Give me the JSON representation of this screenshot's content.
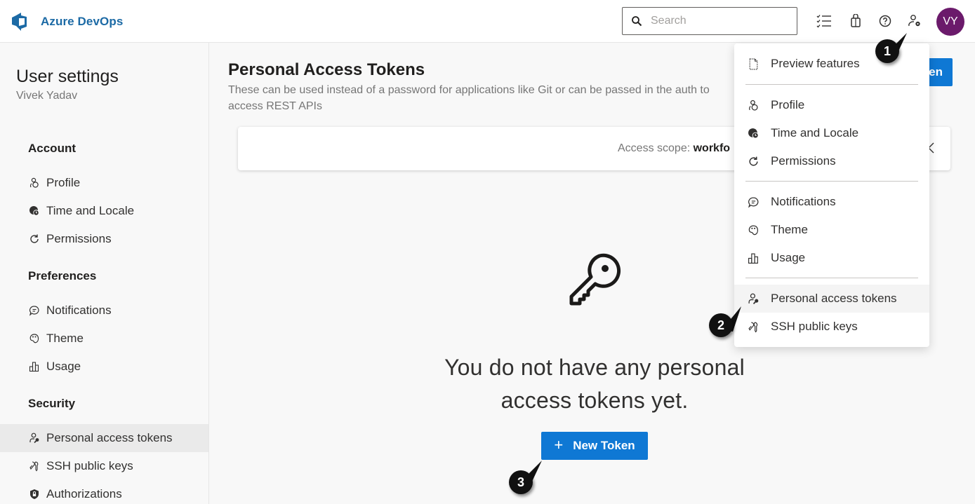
{
  "header": {
    "brand_name": "Azure DevOps",
    "search_placeholder": "Search",
    "search_value": "",
    "icons": [
      "task-list-icon",
      "shopping-bag-icon",
      "help-icon",
      "user-settings-icon"
    ],
    "avatar_initials": "VY",
    "avatar_color": "#6b1a6b",
    "brand_color": "#1c6aa5"
  },
  "sidebar": {
    "title": "User settings",
    "user_name": "Vivek Yadav",
    "groups": [
      {
        "label": "Account",
        "items": [
          {
            "label": "Profile",
            "icon": "profile-icon"
          },
          {
            "label": "Time and Locale",
            "icon": "globe-clock-icon"
          },
          {
            "label": "Permissions",
            "icon": "refresh-icon"
          }
        ]
      },
      {
        "label": "Preferences",
        "items": [
          {
            "label": "Notifications",
            "icon": "chat-icon"
          },
          {
            "label": "Theme",
            "icon": "palette-icon"
          },
          {
            "label": "Usage",
            "icon": "bar-chart-icon"
          }
        ]
      },
      {
        "label": "Security",
        "items": [
          {
            "label": "Personal access tokens",
            "icon": "person-key-icon",
            "selected": true
          },
          {
            "label": "SSH public keys",
            "icon": "keys-icon"
          },
          {
            "label": "Authorizations",
            "icon": "shield-lock-icon"
          }
        ]
      }
    ]
  },
  "main": {
    "title": "Personal Access Tokens",
    "description": "These can be used instead of a password for applications like Git or can be passed in the auth to access REST APIs",
    "top_button_label": "en",
    "scope_label": "Access scope:",
    "scope_value": "workfo",
    "empty_message": "You do not have any personal access tokens yet.",
    "new_token_label": "New Token",
    "accent_color": "#0f78d4"
  },
  "menu": {
    "sections": [
      [
        {
          "label": "Preview features",
          "icon": "document-icon"
        }
      ],
      [
        {
          "label": "Profile",
          "icon": "profile-icon"
        },
        {
          "label": "Time and Locale",
          "icon": "globe-clock-icon"
        },
        {
          "label": "Permissions",
          "icon": "refresh-icon"
        }
      ],
      [
        {
          "label": "Notifications",
          "icon": "chat-icon"
        },
        {
          "label": "Theme",
          "icon": "palette-icon"
        },
        {
          "label": "Usage",
          "icon": "bar-chart-icon"
        }
      ],
      [
        {
          "label": "Personal access tokens",
          "icon": "person-key-icon",
          "hover": true
        },
        {
          "label": "SSH public keys",
          "icon": "keys-icon"
        }
      ]
    ]
  },
  "callouts": [
    "1",
    "2",
    "3"
  ]
}
